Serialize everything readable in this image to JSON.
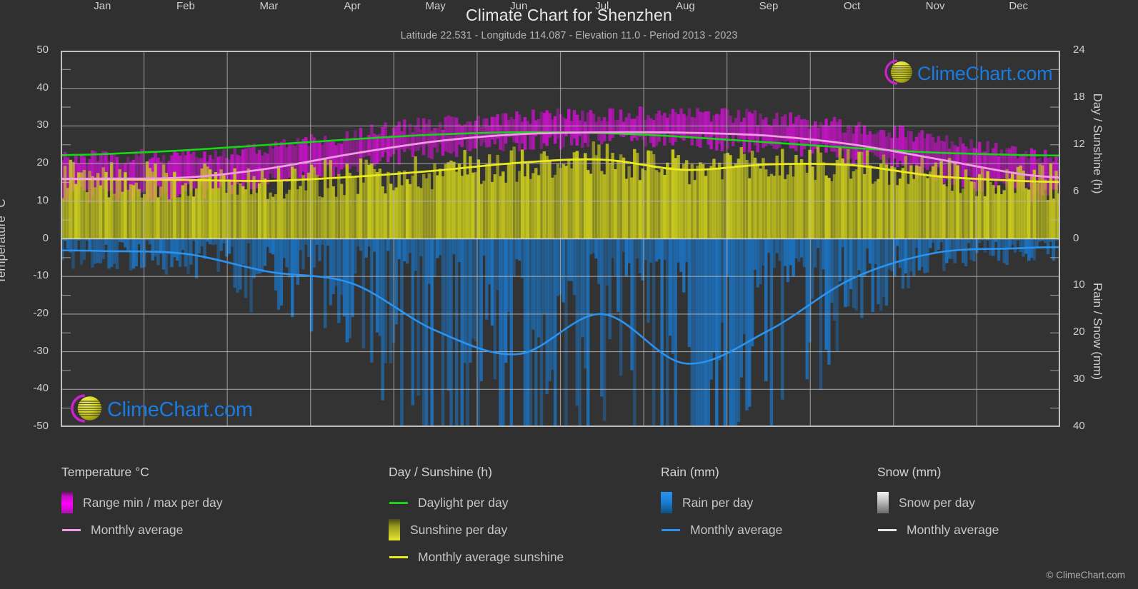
{
  "header": {
    "title": "Climate Chart for Shenzhen",
    "subtitle": "Latitude 22.531 - Longitude 114.087 - Elevation 11.0 - Period 2013 - 2023"
  },
  "logo": {
    "text": "ClimeChart.com",
    "ring_color": "#cc22cc",
    "sphere_color": "#d8d820",
    "text_color": "#1a7be0"
  },
  "footer": {
    "copyright": "© ClimeChart.com"
  },
  "legend": {
    "groups": [
      {
        "title": "Temperature °C",
        "items": [
          {
            "label": "Range min / max per day",
            "marker": "box",
            "swatch": "sw-temp"
          },
          {
            "label": "Monthly average",
            "marker": "line",
            "swatch": "ln-temp"
          }
        ]
      },
      {
        "title": "Day / Sunshine (h)",
        "items": [
          {
            "label": "Daylight per day",
            "marker": "line",
            "swatch": "ln-day"
          },
          {
            "label": "Sunshine per day",
            "marker": "box",
            "swatch": "sw-sun"
          },
          {
            "label": "Monthly average sunshine",
            "marker": "line",
            "swatch": "ln-sun"
          }
        ]
      },
      {
        "title": "Rain (mm)",
        "items": [
          {
            "label": "Rain per day",
            "marker": "box",
            "swatch": "sw-rain"
          },
          {
            "label": "Monthly average",
            "marker": "line",
            "swatch": "ln-rain"
          }
        ]
      },
      {
        "title": "Snow (mm)",
        "items": [
          {
            "label": "Snow per day",
            "marker": "box",
            "swatch": "sw-snow"
          },
          {
            "label": "Monthly average",
            "marker": "line",
            "swatch": "ln-snow"
          }
        ]
      }
    ]
  },
  "chart_data": {
    "type": "area",
    "title": "Climate Chart for Shenzhen",
    "subtitle": "Latitude 22.531 - Longitude 114.087 - Elevation 11.0 - Period 2013 - 2023",
    "categories": [
      "Jan",
      "Feb",
      "Mar",
      "Apr",
      "May",
      "Jun",
      "Jul",
      "Aug",
      "Sep",
      "Oct",
      "Nov",
      "Dec"
    ],
    "xlabel": "",
    "grid": true,
    "legend_position": "below",
    "axes": {
      "left": {
        "label": "Temperature °C",
        "ticks": [
          50,
          40,
          30,
          20,
          10,
          0,
          -10,
          -20,
          -30,
          -40,
          -50
        ],
        "range": [
          -50,
          50
        ],
        "minor_step": 5
      },
      "right_top": {
        "label": "Day / Sunshine (h)",
        "ticks": [
          24,
          18,
          12,
          6,
          0
        ],
        "range": [
          0,
          24
        ],
        "minor_step": 2
      },
      "right_bottom": {
        "label": "Rain / Snow (mm)",
        "ticks": [
          0,
          10,
          20,
          30,
          40
        ],
        "range": [
          0,
          40
        ],
        "minor_step": 2.5
      }
    },
    "series": [
      {
        "name": "Monthly average temperature",
        "unit": "°C",
        "color": "#f09ce4",
        "axis": "left",
        "values": [
          16.0,
          16.3,
          18.7,
          22.6,
          25.9,
          27.8,
          28.3,
          28.2,
          27.4,
          25.1,
          21.3,
          17.3
        ]
      },
      {
        "name": "Range min / max per day",
        "unit": "°C",
        "color": "#c013c0",
        "axis": "left",
        "min_values": [
          11.5,
          12.0,
          14.8,
          19.0,
          23.0,
          25.2,
          25.8,
          25.6,
          24.5,
          21.5,
          17.0,
          12.8
        ],
        "max_values": [
          21.0,
          21.5,
          23.5,
          27.0,
          30.0,
          31.5,
          32.5,
          32.4,
          31.5,
          29.2,
          26.0,
          22.3
        ]
      },
      {
        "name": "Daylight per day",
        "unit": "h",
        "color": "#16d616",
        "axis": "right_top",
        "values": [
          10.8,
          11.3,
          12.0,
          12.7,
          13.3,
          13.6,
          13.5,
          13.0,
          12.3,
          11.6,
          11.0,
          10.7
        ]
      },
      {
        "name": "Monthly average sunshine",
        "unit": "h",
        "color": "#eaea20",
        "axis": "right_top",
        "values": [
          7.6,
          7.5,
          7.4,
          7.9,
          8.7,
          9.7,
          10.1,
          8.8,
          9.5,
          9.4,
          8.0,
          7.4
        ]
      },
      {
        "name": "Monthly average rain",
        "unit": "mm",
        "color": "#2a93ef",
        "axis": "right_bottom",
        "values": [
          2.6,
          3.2,
          7.0,
          9.5,
          19.5,
          24.5,
          16.0,
          26.5,
          19.5,
          8.5,
          3.0,
          2.0
        ]
      },
      {
        "name": "Monthly average snow",
        "unit": "mm",
        "color": "#e6e6e6",
        "axis": "right_bottom",
        "values": [
          0,
          0,
          0,
          0,
          0,
          0,
          0,
          0,
          0,
          0,
          0,
          0
        ]
      }
    ]
  }
}
